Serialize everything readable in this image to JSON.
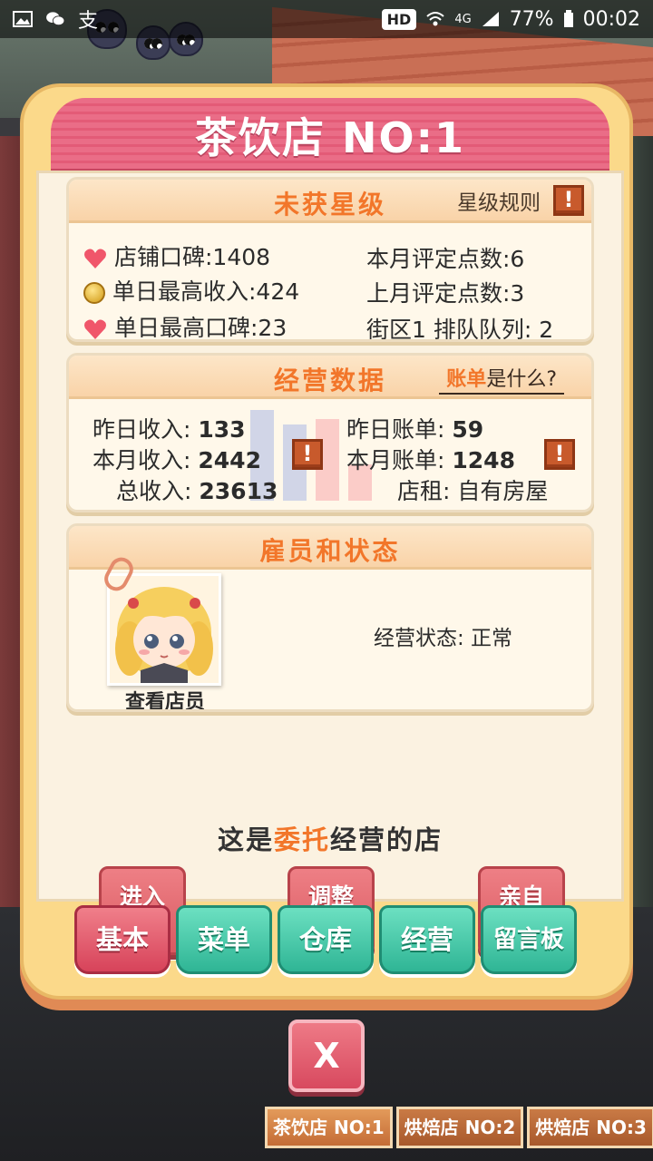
{
  "status_bar": {
    "hd": "HD",
    "network": "4G",
    "battery": "77%",
    "time": "00:02"
  },
  "panel": {
    "title": "茶饮店 NO:1"
  },
  "rating_card": {
    "title": "未获星级",
    "rules_label": "星级规则",
    "excl": "!",
    "shop_reputation": "店铺口碑:1408",
    "max_daily_income": "单日最高收入:424",
    "max_daily_reputation": "单日最高口碑:23",
    "month_points": "本月评定点数:6",
    "last_month_points": "上月评定点数:3",
    "district_queue": "街区1 排队队列: 2"
  },
  "business_card": {
    "title": "经营数据",
    "bill_hl": "账单",
    "bill_rest": "是什么?",
    "excl": "!",
    "yesterday_income_label": "昨日收入:",
    "yesterday_income": "133",
    "month_income_label": "本月收入:",
    "month_income": "2442",
    "total_income_label": "总收入:",
    "total_income": "23613",
    "yesterday_bill_label": "昨日账单:",
    "yesterday_bill": "59",
    "month_bill_label": "本月账单:",
    "month_bill": "1248",
    "rent_label": "店租:",
    "rent": "自有房屋"
  },
  "staff_card": {
    "title": "雇员和状态",
    "view_staff": "查看店员",
    "status": "经营状态: 正常"
  },
  "delegate": {
    "prefix": "这是",
    "highlight": "委托",
    "suffix": "经营的店"
  },
  "actions": {
    "kitchen": "进入厨房",
    "queue": "调整排队",
    "manage": "亲自经营"
  },
  "tabs": [
    "基本",
    "菜单",
    "仓库",
    "经营",
    "留言板"
  ],
  "close": "X",
  "shop_tabs": [
    "茶饮店 NO:1",
    "烘焙店 NO:2",
    "烘焙店 NO:3"
  ],
  "colors": {
    "accent": "#f2762a",
    "header_pink": "#e35b77",
    "tab_green": "#2fb595"
  }
}
